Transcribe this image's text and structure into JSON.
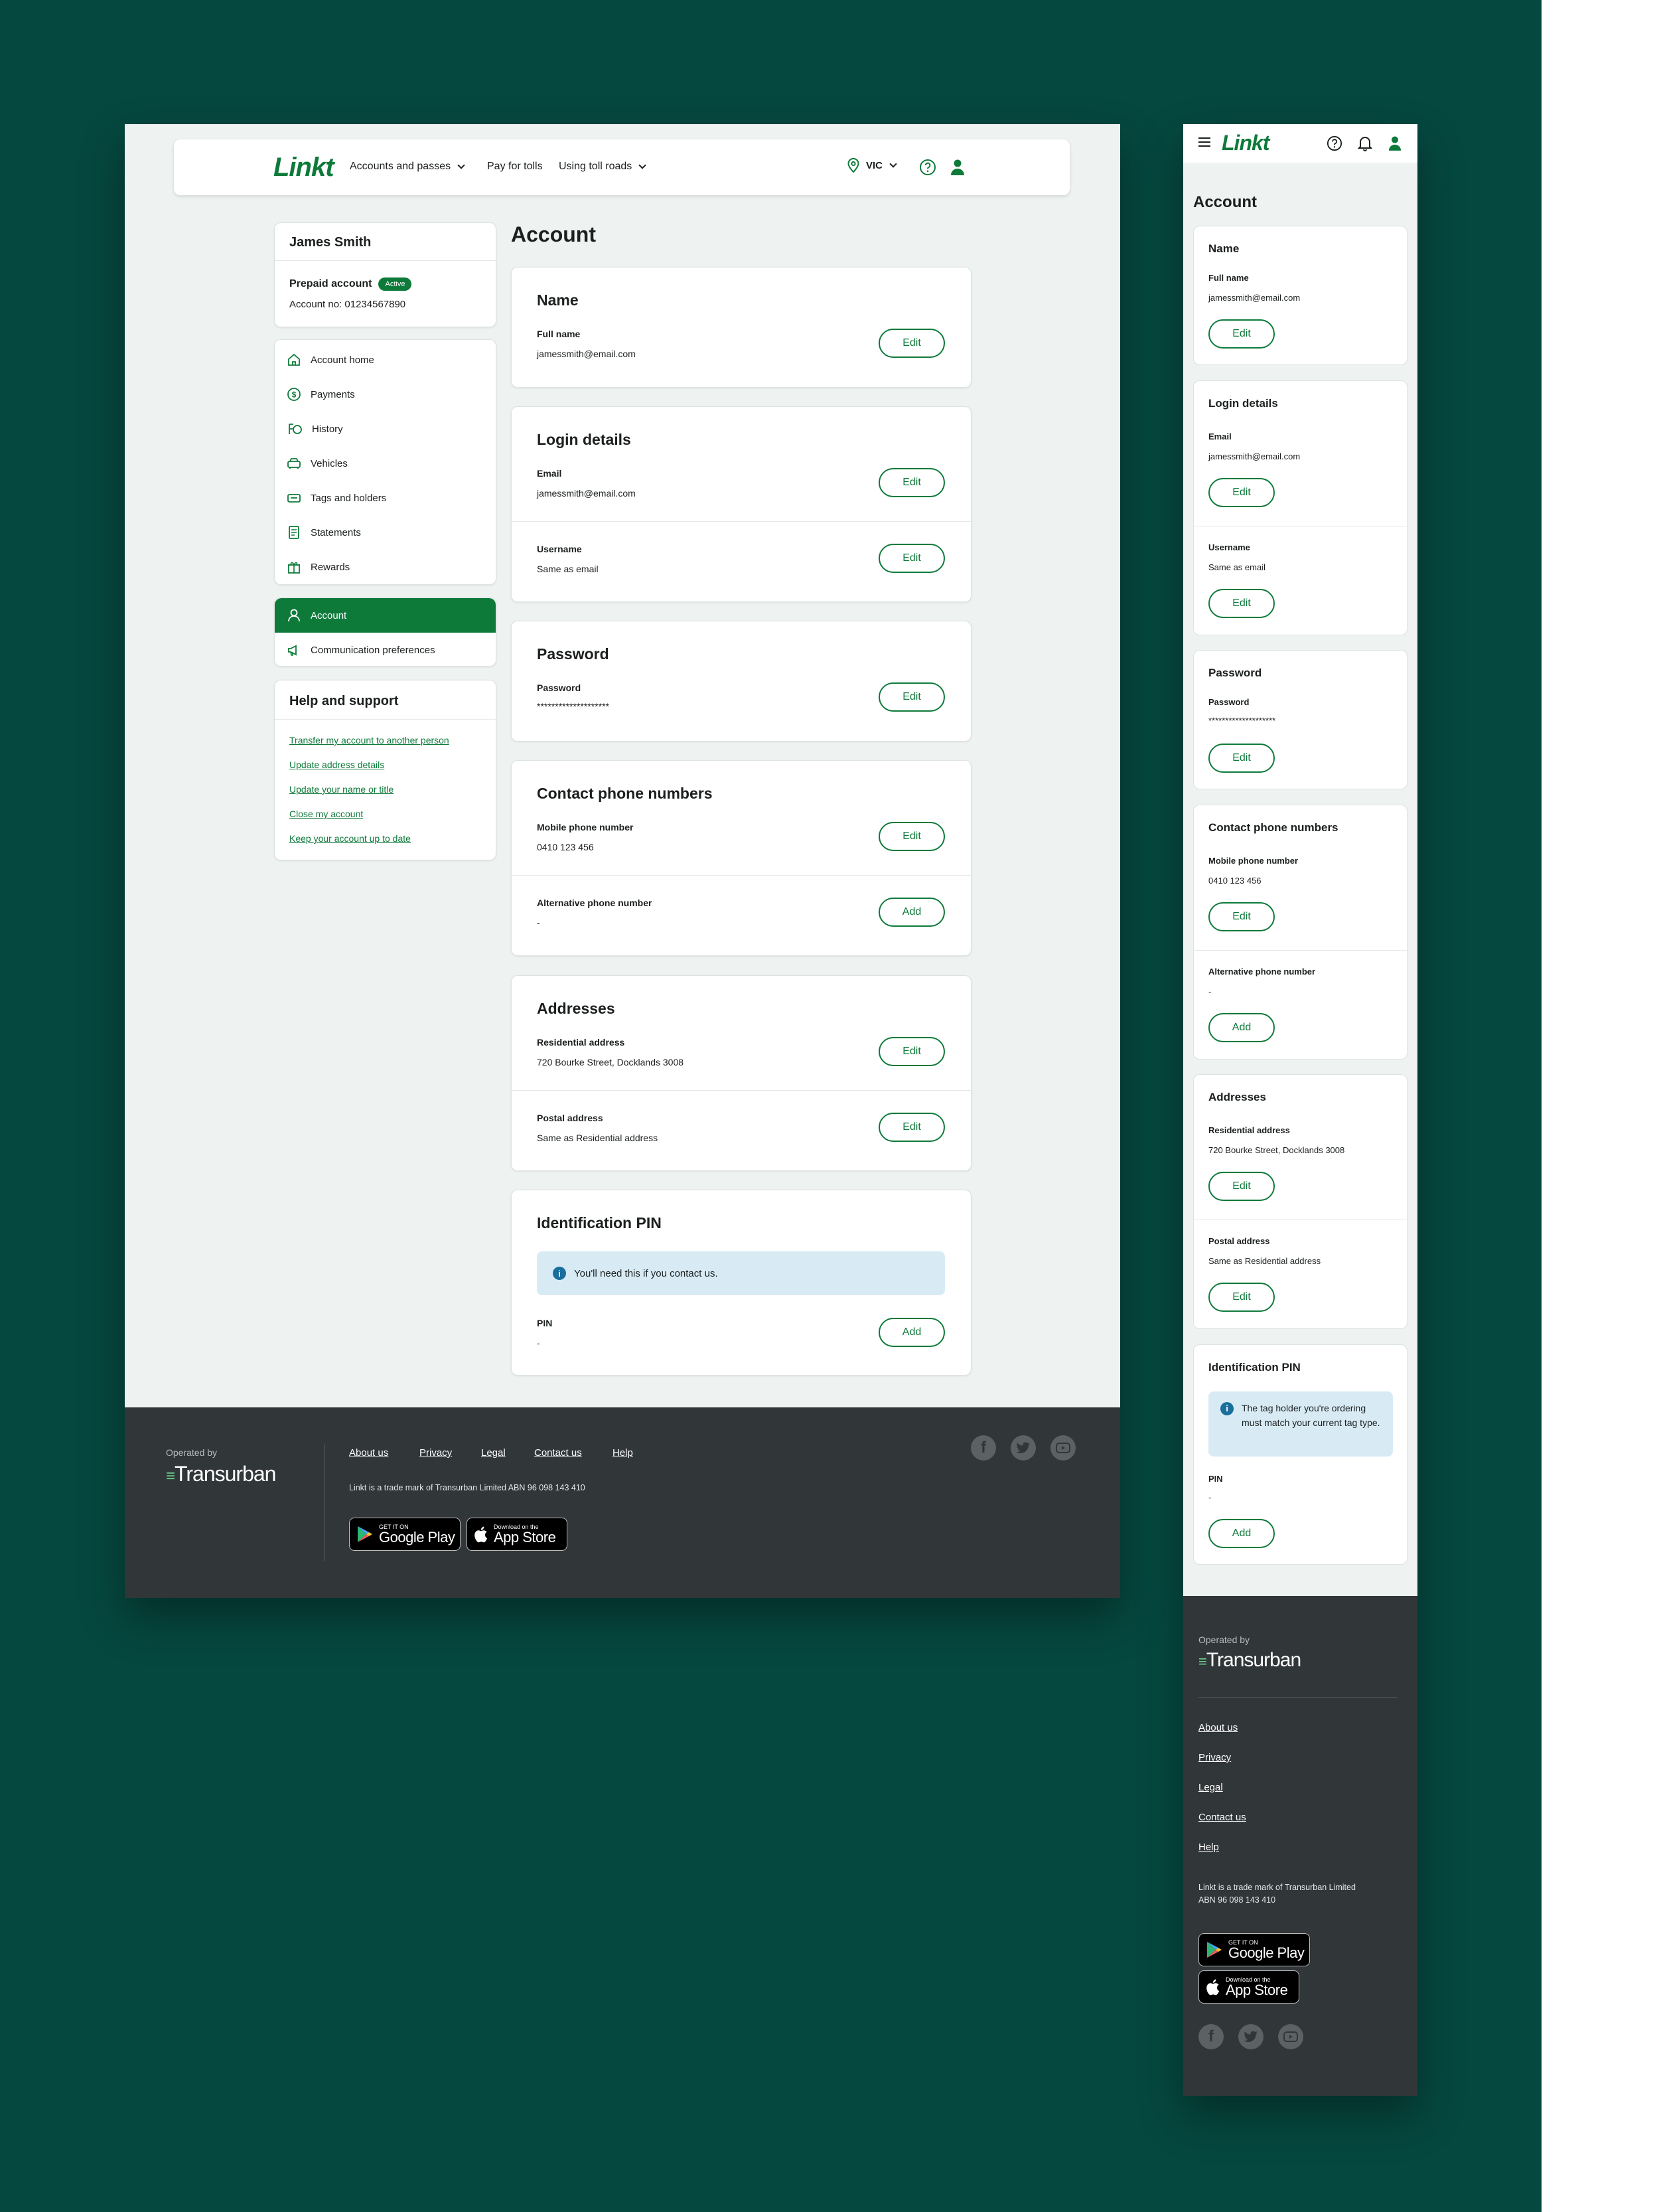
{
  "brand": {
    "logo": "Linkt",
    "operator_label": "Operated by",
    "operator": "Transurban"
  },
  "colors": {
    "brand_green": "#0e7a3a",
    "backdrop": "#05483f",
    "footer": "#313638",
    "info": "#d8ebf5"
  },
  "desktop": {
    "nav": {
      "accounts": "Accounts and passes",
      "pay": "Pay for tolls",
      "using": "Using toll roads",
      "state": "VIC",
      "icons": [
        "location-pin-icon",
        "help-icon",
        "user-icon"
      ]
    },
    "profile": {
      "name": "James Smith",
      "account_type": "Prepaid account",
      "status": "Active",
      "account_no": "Account no: 01234567890"
    },
    "sidebar": {
      "items": [
        {
          "label": "Account home",
          "icon": "home-icon"
        },
        {
          "label": "Payments",
          "icon": "dollar-icon"
        },
        {
          "label": "History",
          "icon": "history-icon"
        },
        {
          "label": "Vehicles",
          "icon": "car-icon"
        },
        {
          "label": "Tags and holders",
          "icon": "tag-icon"
        },
        {
          "label": "Statements",
          "icon": "document-icon"
        },
        {
          "label": "Rewards",
          "icon": "gift-icon"
        }
      ],
      "account_items": [
        {
          "label": "Account",
          "icon": "user-icon",
          "active": true
        },
        {
          "label": "Communication preferences",
          "icon": "megaphone-icon"
        }
      ]
    },
    "help": {
      "title": "Help and support",
      "links": [
        "Transfer my account to another person",
        "Update address details",
        "Update your name or title",
        "Close my account",
        "Keep your account up to date"
      ]
    }
  },
  "account": {
    "title": "Account",
    "name": {
      "title": "Name",
      "label": "Full name",
      "value": "jamessmith@email.com",
      "button": "Edit"
    },
    "login": {
      "title": "Login details",
      "email_label": "Email",
      "email_value": "jamessmith@email.com",
      "username_label": "Username",
      "username_value": "Same as email",
      "button": "Edit"
    },
    "password": {
      "title": "Password",
      "label": "Password",
      "value": "********************",
      "button": "Edit"
    },
    "phones": {
      "title": "Contact phone numbers",
      "mobile_label": "Mobile phone number",
      "mobile_value": "0410 123 456",
      "alt_label": "Alternative phone number",
      "alt_value": "-",
      "edit_button": "Edit",
      "add_button": "Add"
    },
    "addresses": {
      "title": "Addresses",
      "res_label": "Residential address",
      "res_value": "720 Bourke Street, Docklands 3008",
      "postal_label": "Postal address",
      "postal_value": "Same as Residential address",
      "button": "Edit"
    },
    "pin": {
      "title": "Identification PIN",
      "info_desktop": "You'll need this if you contact us.",
      "info_mobile": "The tag holder you're ordering must match your current tag type.",
      "label": "PIN",
      "value": "-",
      "button": "Add"
    }
  },
  "footer": {
    "links": [
      "About us",
      "Privacy",
      "Legal",
      "Contact us",
      "Help"
    ],
    "trademark": "Linkt is a trade mark of Transurban Limited ABN 96 098 143 410",
    "google": {
      "small": "GET IT ON",
      "big": "Google Play"
    },
    "apple": {
      "small": "Download on the",
      "big": "App Store"
    },
    "social": [
      "facebook-icon",
      "twitter-icon",
      "youtube-icon"
    ]
  },
  "mobile": {
    "icons": [
      "menu-icon",
      "help-icon",
      "bell-icon",
      "user-icon"
    ]
  }
}
